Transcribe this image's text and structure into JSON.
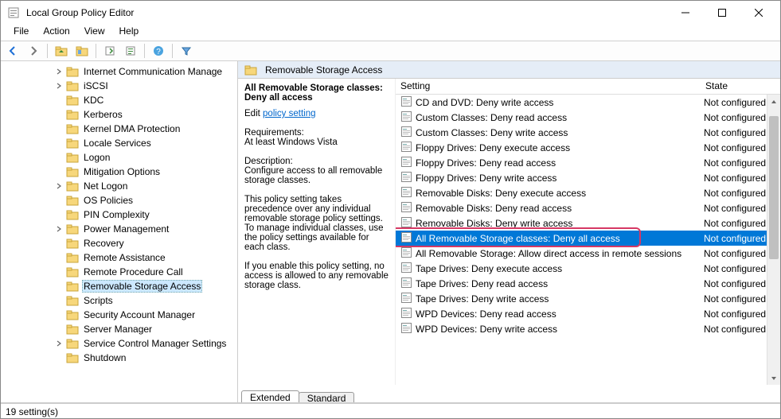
{
  "window_title": "Local Group Policy Editor",
  "menus": [
    "File",
    "Action",
    "View",
    "Help"
  ],
  "tree": [
    {
      "label": "Internet Communication Manage",
      "indent": 4,
      "twist": "right"
    },
    {
      "label": "iSCSI",
      "indent": 4,
      "twist": "right"
    },
    {
      "label": "KDC",
      "indent": 4,
      "twist": ""
    },
    {
      "label": "Kerberos",
      "indent": 4,
      "twist": ""
    },
    {
      "label": "Kernel DMA Protection",
      "indent": 4,
      "twist": ""
    },
    {
      "label": "Locale Services",
      "indent": 4,
      "twist": ""
    },
    {
      "label": "Logon",
      "indent": 4,
      "twist": ""
    },
    {
      "label": "Mitigation Options",
      "indent": 4,
      "twist": ""
    },
    {
      "label": "Net Logon",
      "indent": 4,
      "twist": "right"
    },
    {
      "label": "OS Policies",
      "indent": 4,
      "twist": ""
    },
    {
      "label": "PIN Complexity",
      "indent": 4,
      "twist": ""
    },
    {
      "label": "Power Management",
      "indent": 4,
      "twist": "right"
    },
    {
      "label": "Recovery",
      "indent": 4,
      "twist": ""
    },
    {
      "label": "Remote Assistance",
      "indent": 4,
      "twist": ""
    },
    {
      "label": "Remote Procedure Call",
      "indent": 4,
      "twist": ""
    },
    {
      "label": "Removable Storage Access",
      "indent": 4,
      "twist": "",
      "selected": true
    },
    {
      "label": "Scripts",
      "indent": 4,
      "twist": ""
    },
    {
      "label": "Security Account Manager",
      "indent": 4,
      "twist": ""
    },
    {
      "label": "Server Manager",
      "indent": 4,
      "twist": ""
    },
    {
      "label": "Service Control Manager Settings",
      "indent": 4,
      "twist": "right"
    },
    {
      "label": "Shutdown",
      "indent": 4,
      "twist": ""
    }
  ],
  "right_header": "Removable Storage Access",
  "detail": {
    "title": "All Removable Storage classes: Deny all access",
    "edit_label": "Edit",
    "edit_link": "policy setting",
    "req_label": "Requirements:",
    "req_text": "At least Windows Vista",
    "desc_label": "Description:",
    "desc_text": "Configure access to all removable storage classes.",
    "body1": "This policy setting takes precedence over any individual removable storage policy settings. To manage individual classes, use the policy settings available for each class.",
    "body2": "If you enable this policy setting, no access is allowed to any removable storage class."
  },
  "columns": {
    "setting": "Setting",
    "state": "State"
  },
  "settings": [
    {
      "name": "CD and DVD: Deny write access",
      "state": "Not configured"
    },
    {
      "name": "Custom Classes: Deny read access",
      "state": "Not configured"
    },
    {
      "name": "Custom Classes: Deny write access",
      "state": "Not configured"
    },
    {
      "name": "Floppy Drives: Deny execute access",
      "state": "Not configured"
    },
    {
      "name": "Floppy Drives: Deny read access",
      "state": "Not configured"
    },
    {
      "name": "Floppy Drives: Deny write access",
      "state": "Not configured"
    },
    {
      "name": "Removable Disks: Deny execute access",
      "state": "Not configured"
    },
    {
      "name": "Removable Disks: Deny read access",
      "state": "Not configured"
    },
    {
      "name": "Removable Disks: Deny write access",
      "state": "Not configured"
    },
    {
      "name": "All Removable Storage classes: Deny all access",
      "state": "Not configured",
      "selected": true,
      "highlight": true
    },
    {
      "name": "All Removable Storage: Allow direct access in remote sessions",
      "state": "Not configured"
    },
    {
      "name": "Tape Drives: Deny execute access",
      "state": "Not configured"
    },
    {
      "name": "Tape Drives: Deny read access",
      "state": "Not configured"
    },
    {
      "name": "Tape Drives: Deny write access",
      "state": "Not configured"
    },
    {
      "name": "WPD Devices: Deny read access",
      "state": "Not configured"
    },
    {
      "name": "WPD Devices: Deny write access",
      "state": "Not configured"
    }
  ],
  "tabs": [
    "Extended",
    "Standard"
  ],
  "active_tab": 0,
  "statusbar": "19 setting(s)"
}
